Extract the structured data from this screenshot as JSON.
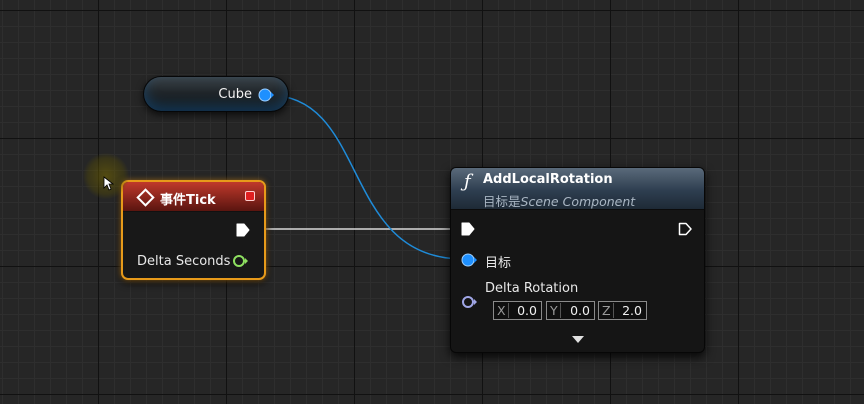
{
  "variable_node": {
    "label": "Cube",
    "pin_color": "#1e90ff"
  },
  "event_node": {
    "title": "事件Tick",
    "header_color": "#c0392b",
    "border_color": "#e79a1a",
    "delta_label": "Delta Seconds",
    "delta_pin_color": "#8ee060",
    "icons": [
      "diamond-icon",
      "delegate-icon",
      "exec-pin-icon"
    ]
  },
  "function_node": {
    "icon": "ƒ",
    "title": "AddLocalRotation",
    "subtitle_prefix": "目标是",
    "subtitle_class": "Scene Component",
    "target_label": "目标",
    "delta_rotation_label": "Delta Rotation",
    "rotation": {
      "x_axis": "X",
      "x": "0.0",
      "y_axis": "Y",
      "y": "0.0",
      "z_axis": "Z",
      "z": "2.0"
    },
    "target_pin_color": "#1e90ff",
    "rotation_pin_color": "#a0a6e6"
  },
  "wires": [
    {
      "from": "Cube",
      "to": "目标",
      "color": "#1f8bd8"
    },
    {
      "from": "事件Tick exec",
      "to": "AddLocalRotation exec",
      "color": "#e8e8e8"
    }
  ]
}
